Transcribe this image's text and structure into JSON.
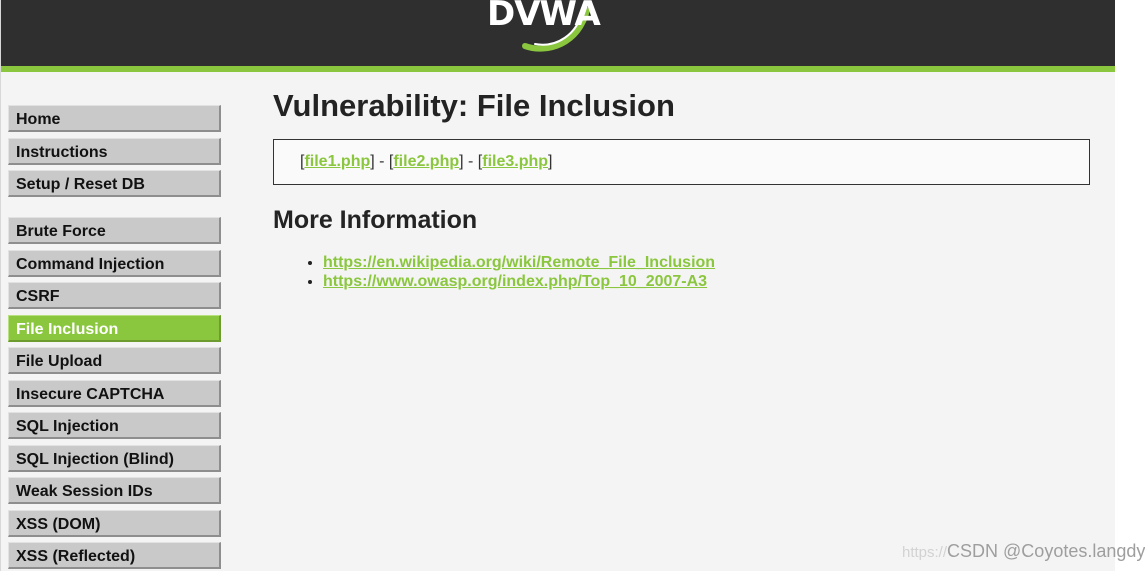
{
  "header": {
    "logo_text": "DVWA"
  },
  "sidebar": {
    "groups": [
      [
        {
          "label": "Home"
        },
        {
          "label": "Instructions"
        },
        {
          "label": "Setup / Reset DB"
        }
      ],
      [
        {
          "label": "Brute Force"
        },
        {
          "label": "Command Injection"
        },
        {
          "label": "CSRF"
        },
        {
          "label": "File Inclusion",
          "selected": true
        },
        {
          "label": "File Upload"
        },
        {
          "label": "Insecure CAPTCHA"
        },
        {
          "label": "SQL Injection"
        },
        {
          "label": "SQL Injection (Blind)"
        },
        {
          "label": "Weak Session IDs"
        },
        {
          "label": "XSS (DOM)"
        },
        {
          "label": "XSS (Reflected)"
        }
      ]
    ]
  },
  "main": {
    "title": "Vulnerability: File Inclusion",
    "files": [
      "file1.php",
      "file2.php",
      "file3.php"
    ],
    "more_info_title": "More Information",
    "links": [
      "https://en.wikipedia.org/wiki/Remote_File_Inclusion",
      "https://www.owasp.org/index.php/Top_10_2007-A3"
    ]
  },
  "watermark": {
    "faint": "https://",
    "text": "CSDN @Coyotes.langdy"
  },
  "colors": {
    "accent": "#8bc63f",
    "header_bg": "#2f2f2f",
    "menu_bg": "#c9c9c9",
    "page_bg": "#f4f4f4"
  }
}
